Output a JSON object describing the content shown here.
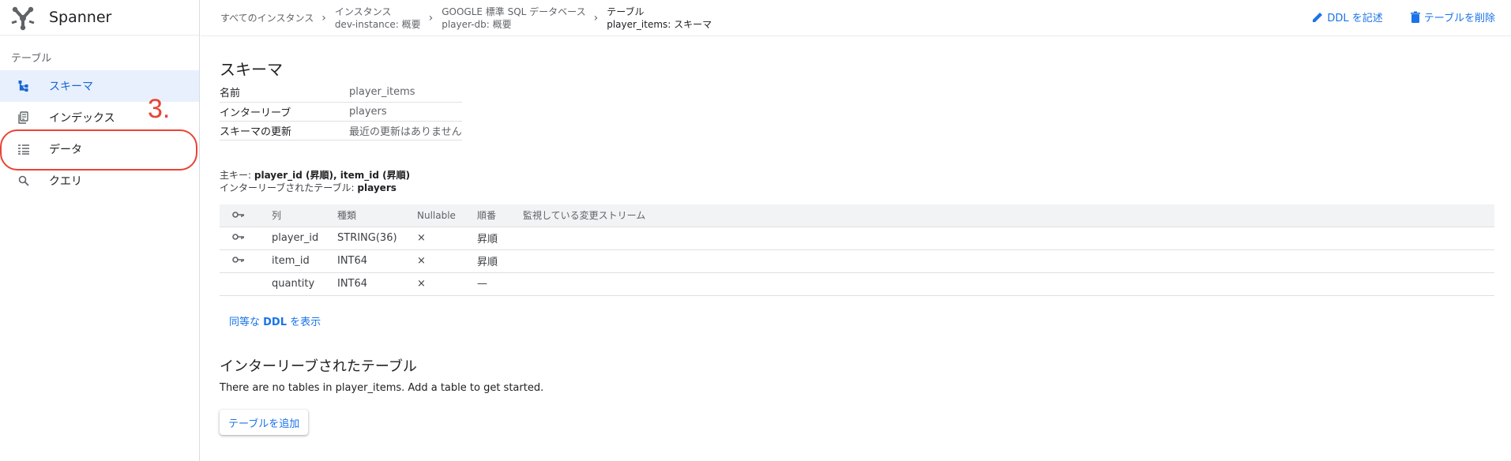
{
  "app": {
    "name": "Spanner"
  },
  "sidebar": {
    "section_label": "テーブル",
    "items": [
      {
        "label": "スキーマ",
        "icon": "schema-icon",
        "active": true
      },
      {
        "label": "インデックス",
        "icon": "index-icon",
        "active": false
      },
      {
        "label": "データ",
        "icon": "data-icon",
        "active": false
      },
      {
        "label": "クエリ",
        "icon": "search-icon",
        "active": false
      }
    ]
  },
  "annotation": {
    "label": "3.",
    "color": "#ea4335"
  },
  "breadcrumb": [
    {
      "line1": "すべてのインスタンス",
      "line2": ""
    },
    {
      "line1": "インスタンス",
      "line2": "dev-instance: 概要"
    },
    {
      "line1": "GOOGLE 標準 SQL データベース",
      "line2": "player-db: 概要"
    },
    {
      "line1": "テーブル",
      "line2": "player_items: スキーマ"
    }
  ],
  "header_actions": {
    "write_ddl": "DDL を記述",
    "delete_table": "テーブルを削除"
  },
  "schema": {
    "title": "スキーマ",
    "properties": [
      {
        "key": "名前",
        "value": "player_items"
      },
      {
        "key": "インターリーブ",
        "value": "players"
      },
      {
        "key": "スキーマの更新",
        "value": "最近の更新はありません"
      }
    ],
    "primary_key_label": "主キー: ",
    "primary_key_value": "player_id (昇順), item_id (昇順)",
    "interleaved_label": "インターリーブされたテーブル: ",
    "interleaved_value": "players"
  },
  "columns_table": {
    "headers": [
      "列",
      "種類",
      "Nullable",
      "順番",
      "監視している変更ストリーム"
    ],
    "rows": [
      {
        "is_key": true,
        "name": "player_id",
        "type": "STRING(36)",
        "nullable": "×",
        "order": "昇順",
        "streams": ""
      },
      {
        "is_key": true,
        "name": "item_id",
        "type": "INT64",
        "nullable": "×",
        "order": "昇順",
        "streams": ""
      },
      {
        "is_key": false,
        "name": "quantity",
        "type": "INT64",
        "nullable": "×",
        "order": "—",
        "streams": ""
      }
    ]
  },
  "ddl_link": {
    "prefix": "同等な ",
    "bold": "DDL",
    "suffix": " を表示"
  },
  "interleaved_section": {
    "title": "インターリーブされたテーブル",
    "empty_message": "There are no tables in player_items. Add a table to get started.",
    "add_button": "テーブルを追加"
  },
  "colors": {
    "accent": "#1a73e8",
    "active_bg": "#e8f0fe",
    "annotation": "#ea4335"
  }
}
